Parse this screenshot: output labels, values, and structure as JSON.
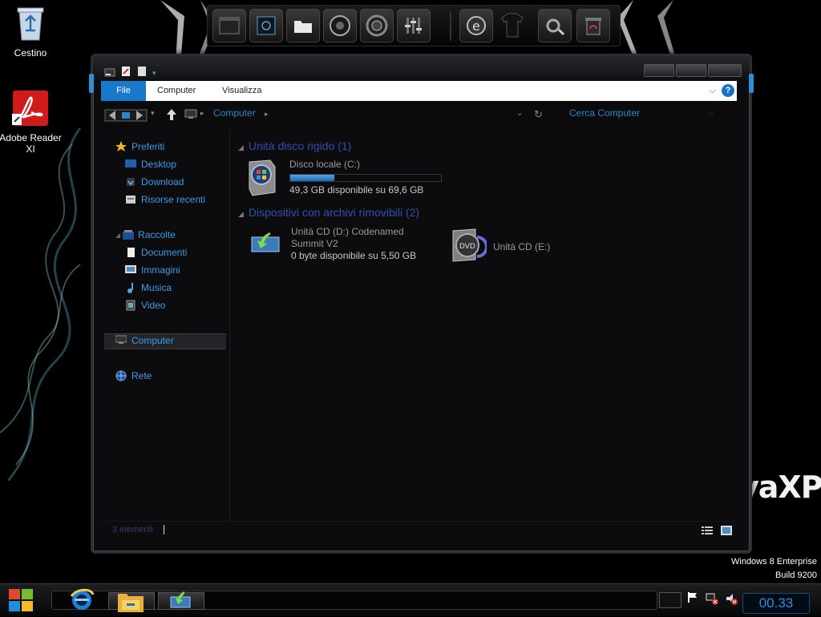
{
  "desktop": {
    "icons": [
      {
        "label": "Cestino",
        "icon": "recycle-bin-icon"
      },
      {
        "label": "Adobe Reader XI",
        "icon": "adobe-reader-icon"
      }
    ],
    "brand_text": "vaXP",
    "winver_line1": "Windows 8 Enterprise",
    "winver_line2": "Build 9200"
  },
  "dock": {
    "items": [
      "window-icon",
      "network-icon",
      "folder-icon",
      "disc-icon",
      "speaker-icon",
      "equalizer-icon",
      "internet-explorer-icon",
      "shirt-icon",
      "settings-icon",
      "recycle-icon"
    ]
  },
  "explorer": {
    "ribbon": {
      "tabs": [
        "File",
        "Computer",
        "Visualizza"
      ],
      "expand_icon": "chevron-down-icon",
      "help_label": "?"
    },
    "address": {
      "path": "Computer",
      "search_placeholder": "Cerca Computer"
    },
    "nav": {
      "favorites_header": "Preferiti",
      "favorites": [
        "Desktop",
        "Download",
        "Risorse recenti"
      ],
      "libraries_header": "Raccolte",
      "libraries": [
        "Documenti",
        "Immagini",
        "Musica",
        "Video"
      ],
      "computer": "Computer",
      "network": "Rete"
    },
    "groups": {
      "hdd_title": "Unità disco rigido (1)",
      "removable_title": "Dispositivi con archivi rimovibili (2)"
    },
    "drives": {
      "c_name": "Disco locale (C:)",
      "c_free": "49,3 GB disponibile su 69,6 GB",
      "c_used_fraction": 0.29,
      "d_name_line1": "Unità CD (D:) Codenamed",
      "d_name_line2": "Summit V2",
      "d_free": "0 byte disponibile su 5,50 GB",
      "e_name": "Unità CD (E:)"
    },
    "status": {
      "count": "3 elementi"
    }
  },
  "taskbar": {
    "clock": "00.33",
    "items": [
      "internet-explorer-icon",
      "file-explorer-icon",
      "install-icon"
    ]
  },
  "colors": {
    "accent": "#1979ca",
    "link": "#3b9be8",
    "group_title": "#2f4fb5"
  }
}
